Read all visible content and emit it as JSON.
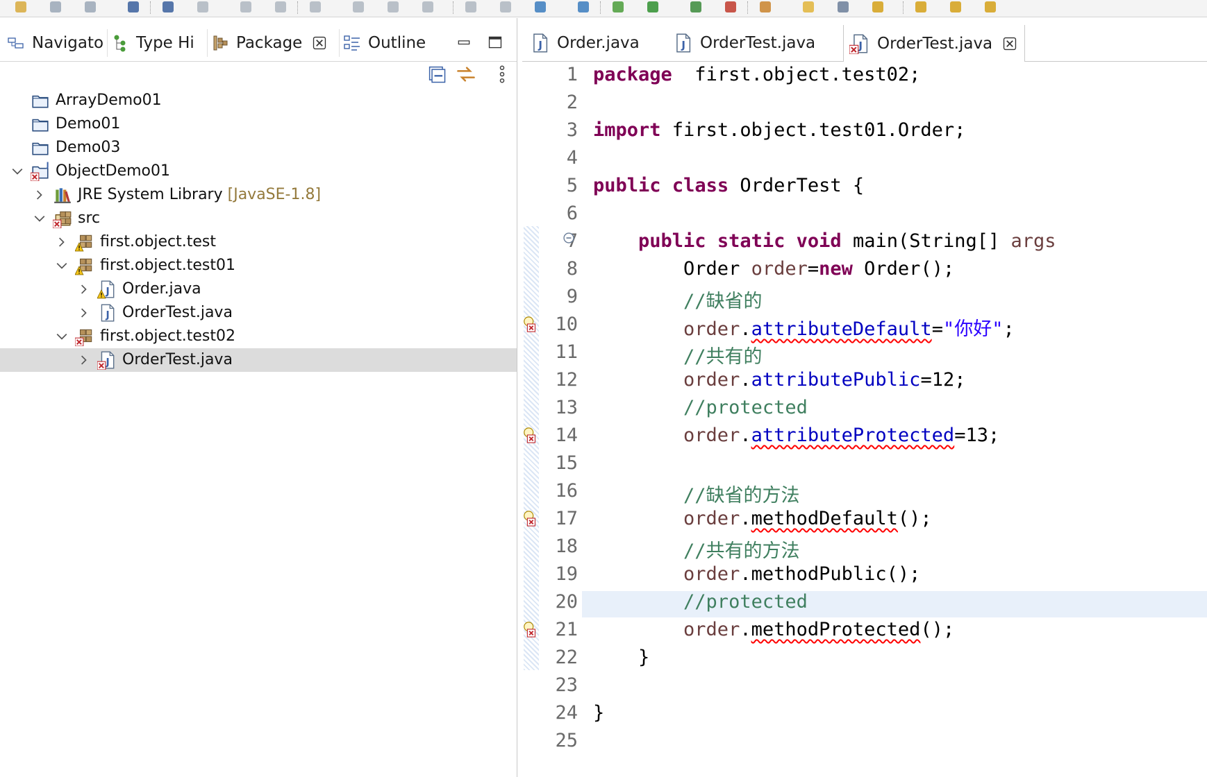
{
  "toolbar": {
    "icons": [
      "new-icon",
      "save-icon",
      "save-all-icon",
      "print-icon",
      "search-icon",
      "resume-icon",
      "suspend-icon",
      "terminate-icon",
      "disconnect-icon",
      "step-into-icon",
      "step-over-icon",
      "step-return-icon",
      "drop-to-frame-icon",
      "use-step-filters-icon",
      "globe-icon",
      "run-server-icon",
      "debug-icon",
      "run-icon",
      "coverage-icon",
      "external-tools-icon",
      "open-type-icon",
      "pencil-icon",
      "task-icon",
      "prev-annotation-icon",
      "next-annotation-icon",
      "back-icon",
      "forward-icon"
    ]
  },
  "left_panel": {
    "tabs": [
      {
        "label": "Navigato",
        "icon": "navigator-icon"
      },
      {
        "label": "Type Hi",
        "icon": "type-hierarchy-icon"
      },
      {
        "label": "Package",
        "icon": "package-explorer-icon",
        "active": true
      },
      {
        "label": "Outline",
        "icon": "outline-icon"
      }
    ],
    "view_toolbar": [
      "collapse-all-icon",
      "link-with-editor-icon",
      "view-menu-icon"
    ],
    "tree": [
      {
        "label": "ArrayDemo01",
        "icon": "folder-icon",
        "level": 0,
        "expand": "none"
      },
      {
        "label": "Demo01",
        "icon": "folder-icon",
        "level": 0,
        "expand": "none"
      },
      {
        "label": "Demo03",
        "icon": "folder-icon",
        "level": 0,
        "expand": "none"
      },
      {
        "label": "ObjectDemo01",
        "icon": "java-project-error-icon",
        "level": 0,
        "expand": "open"
      },
      {
        "label": "JRE System Library",
        "decor": "[JavaSE-1.8]",
        "icon": "library-icon",
        "level": 1,
        "expand": "closed"
      },
      {
        "label": "src",
        "icon": "source-folder-error-icon",
        "level": 1,
        "expand": "open"
      },
      {
        "label": "first.object.test",
        "icon": "package-warning-icon",
        "level": 2,
        "expand": "closed"
      },
      {
        "label": "first.object.test01",
        "icon": "package-warning-icon",
        "level": 2,
        "expand": "open"
      },
      {
        "label": "Order.java",
        "icon": "java-file-warning-icon",
        "level": 3,
        "expand": "closed"
      },
      {
        "label": "OrderTest.java",
        "icon": "java-file-icon",
        "level": 3,
        "expand": "closed"
      },
      {
        "label": "first.object.test02",
        "icon": "package-error-icon",
        "level": 2,
        "expand": "open"
      },
      {
        "label": "OrderTest.java",
        "icon": "java-file-error-icon",
        "level": 3,
        "expand": "closed",
        "selected": true
      }
    ]
  },
  "editor": {
    "tabs": [
      {
        "label": "Order.java",
        "icon": "java-file-icon"
      },
      {
        "label": "OrderTest.java",
        "icon": "java-file-icon"
      },
      {
        "label": "OrderTest.java",
        "icon": "java-file-error-icon",
        "active": true
      }
    ],
    "current_line": 20,
    "lines": [
      {
        "n": "1",
        "tokens": [
          [
            "kw",
            "package"
          ],
          [
            "",
            "  first.object.test02;"
          ]
        ]
      },
      {
        "n": "2",
        "tokens": []
      },
      {
        "n": "3",
        "tokens": [
          [
            "kw",
            "import"
          ],
          [
            "",
            " first.object.test01.Order;"
          ]
        ]
      },
      {
        "n": "4",
        "tokens": []
      },
      {
        "n": "5",
        "tokens": [
          [
            "kw",
            "public"
          ],
          [
            "",
            " "
          ],
          [
            "kw",
            "class"
          ],
          [
            "",
            " OrderTest {"
          ]
        ]
      },
      {
        "n": "6",
        "tokens": []
      },
      {
        "n": "7",
        "fold": true,
        "tokens": [
          [
            "",
            "    "
          ],
          [
            "kw",
            "public"
          ],
          [
            "",
            " "
          ],
          [
            "kw",
            "static"
          ],
          [
            "",
            " "
          ],
          [
            "kw",
            "void"
          ],
          [
            "",
            " main(String[] "
          ],
          [
            "var",
            "args"
          ],
          [
            ") {"
          ]
        ]
      },
      {
        "n": "8",
        "tokens": [
          [
            "",
            "        Order "
          ],
          [
            "var",
            "order"
          ],
          [
            "",
            "="
          ],
          [
            "kw",
            "new"
          ],
          [
            "",
            " Order();"
          ]
        ]
      },
      {
        "n": "9",
        "tokens": [
          [
            "cmt",
            "        //缺省的"
          ]
        ]
      },
      {
        "n": "10",
        "marker": "error",
        "tokens": [
          [
            "var",
            "        order"
          ],
          [
            "",
            "."
          ],
          [
            "field err",
            "attributeDefault"
          ],
          [
            "",
            "="
          ],
          [
            "str",
            "\"你好\""
          ],
          [
            "",
            ";"
          ]
        ]
      },
      {
        "n": "11",
        "tokens": [
          [
            "cmt",
            "        //共有的"
          ]
        ]
      },
      {
        "n": "12",
        "tokens": [
          [
            "var",
            "        order"
          ],
          [
            "",
            "."
          ],
          [
            "field",
            "attributePublic"
          ],
          [
            "",
            "=12;"
          ]
        ]
      },
      {
        "n": "13",
        "tokens": [
          [
            "cmt",
            "        //protected"
          ]
        ]
      },
      {
        "n": "14",
        "marker": "error",
        "tokens": [
          [
            "var",
            "        order"
          ],
          [
            "",
            "."
          ],
          [
            "field err",
            "attributeProtected"
          ],
          [
            "",
            "=13;"
          ]
        ]
      },
      {
        "n": "15",
        "tokens": []
      },
      {
        "n": "16",
        "tokens": [
          [
            "cmt",
            "        //缺省的方法"
          ]
        ]
      },
      {
        "n": "17",
        "marker": "error",
        "tokens": [
          [
            "var",
            "        order"
          ],
          [
            "",
            "."
          ],
          [
            "err",
            "methodDefault"
          ],
          [
            "",
            "();"
          ]
        ]
      },
      {
        "n": "18",
        "tokens": [
          [
            "cmt",
            "        //共有的方法"
          ]
        ]
      },
      {
        "n": "19",
        "tokens": [
          [
            "var",
            "        order"
          ],
          [
            "",
            ".methodPublic();"
          ]
        ]
      },
      {
        "n": "20",
        "tokens": [
          [
            "cmt",
            "        //protected"
          ]
        ]
      },
      {
        "n": "21",
        "marker": "error",
        "tokens": [
          [
            "var",
            "        order"
          ],
          [
            "",
            "."
          ],
          [
            "err",
            "methodProtected"
          ],
          [
            "",
            "();"
          ]
        ]
      },
      {
        "n": "22",
        "tokens": [
          [
            "",
            "    }"
          ]
        ]
      },
      {
        "n": "23",
        "tokens": []
      },
      {
        "n": "24",
        "tokens": [
          [
            "",
            "}"
          ]
        ]
      },
      {
        "n": "25",
        "tokens": []
      }
    ]
  },
  "colors": {
    "keyword": "#7f0055",
    "field": "#0000c0",
    "string": "#2a00ff",
    "comment": "#3f7f5f",
    "local_variable": "#6a3e3e",
    "error_underline": "#ff0000",
    "selection": "#dcdcdc",
    "current_line": "#e8f0fa"
  }
}
